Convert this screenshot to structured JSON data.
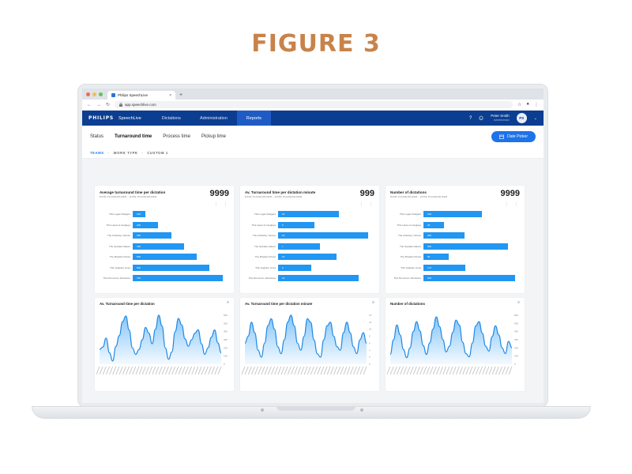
{
  "figure": {
    "title": "FIGURE 3"
  },
  "browser": {
    "tab_title": "Philips SpeechLive",
    "close_glyph": "×",
    "new_tab_glyph": "+",
    "url": "app.speechlive.com",
    "lock_icon": "lock-icon",
    "window_dot_colors": [
      "#ec6a5e",
      "#f4bf4f",
      "#61c554"
    ]
  },
  "header": {
    "brand": "PHILIPS",
    "product": "SpeechLive",
    "nav": [
      "Dictations",
      "Administration",
      "Reports"
    ],
    "active_nav": "Reports",
    "help": "?",
    "user_name": "Peter Smith",
    "user_sub": "Administrator",
    "avatar_initials": "PS",
    "colors": {
      "header_bg": "#0b3d91",
      "active_nav_bg": "#1f5bc4"
    }
  },
  "subnav": {
    "tabs": [
      "Status",
      "Turnaround time",
      "Process time",
      "Pickup time"
    ],
    "active_tab": "Turnaround time",
    "date_picker": "Date Picker"
  },
  "filters": {
    "items": [
      "TEAMS",
      "WORK TYPE",
      "CUSTOM 1"
    ],
    "separator": "·",
    "active": "TEAMS"
  },
  "bar_cards": [
    {
      "title": "Average turnaround time per dictation",
      "subtitle": "DATE PLACEHOLDER – DATE PLACEHOLDER",
      "value": "9999",
      "rows": [
        {
          "label": "This Logan Rodgers",
          "value": "100",
          "fraction": 0.14
        },
        {
          "label": "This Laura of Langleys",
          "value": "200",
          "fraction": 0.28
        },
        {
          "label": "The Amberley Joneze",
          "value": "300",
          "fraction": 0.42
        },
        {
          "label": "The Sysrake Nelson",
          "value": "400",
          "fraction": 0.56
        },
        {
          "label": "The Brooklyn Press",
          "value": "500",
          "fraction": 0.7
        },
        {
          "label": "This Jeighton Lines",
          "value": "600",
          "fraction": 0.84
        },
        {
          "label": "This Drummon Johnstone",
          "value": "700",
          "fraction": 0.98
        }
      ]
    },
    {
      "title": "Av. Turnaround time per dictation minute",
      "subtitle": "DATE PLACEHOLDER – DATE PLACEHOLDER",
      "value": "999",
      "rows": [
        {
          "label": "This Logan Rodgers",
          "value": "10",
          "fraction": 0.66
        },
        {
          "label": "This Laura of Langleys",
          "value": "6",
          "fraction": 0.4
        },
        {
          "label": "The Amberley Joneze",
          "value": "10",
          "fraction": 0.98
        },
        {
          "label": "The Sysrake Nelson",
          "value": "7",
          "fraction": 0.46
        },
        {
          "label": "The Brooklyn Press",
          "value": "10",
          "fraction": 0.64
        },
        {
          "label": "This Jeighton Lines",
          "value": "6",
          "fraction": 0.36
        },
        {
          "label": "This Drummon Johnstone",
          "value": "10",
          "fraction": 0.88
        }
      ]
    },
    {
      "title": "Number of dictations",
      "subtitle": "DATE PLACEHOLDER – DATE PLACEHOLDER",
      "value": "9999",
      "rows": [
        {
          "label": "This Logan Rodgers",
          "value": "100",
          "fraction": 0.64
        },
        {
          "label": "This Laura of Langleys",
          "value": "30",
          "fraction": 0.22
        },
        {
          "label": "The Amberley Joneze",
          "value": "200",
          "fraction": 0.45
        },
        {
          "label": "The Sysrake Nelson",
          "value": "300",
          "fraction": 0.92
        },
        {
          "label": "The Brooklyn Press",
          "value": "50",
          "fraction": 0.28
        },
        {
          "label": "This Jeighton Lines",
          "value": "170",
          "fraction": 0.46
        },
        {
          "label": "This Drummon Johnstone",
          "value": "200",
          "fraction": 1.0
        }
      ]
    }
  ],
  "area_cards": [
    {
      "title": "Av. Turnaround time per dictation",
      "menu_glyph": "≡",
      "y_ticks": [
        "600",
        "500",
        "400",
        "300",
        "200",
        "100",
        "0"
      ],
      "values": [
        180,
        210,
        320,
        140,
        40,
        220,
        350,
        520,
        590,
        420,
        200,
        120,
        180,
        300,
        450,
        380,
        250,
        430,
        600,
        470,
        200,
        60,
        150,
        400,
        560,
        480,
        310,
        220,
        300,
        380,
        420,
        250,
        120,
        200,
        330,
        420,
        260,
        140
      ]
    },
    {
      "title": "Av. Turnaround time per dictation minute",
      "menu_glyph": "≡",
      "y_ticks": [
        "14",
        "12",
        "10",
        "8",
        "6",
        "4",
        "2",
        "0"
      ],
      "values": [
        6,
        8,
        12,
        9,
        4,
        2,
        6,
        11,
        13,
        10,
        5,
        3,
        7,
        12,
        14,
        11,
        6,
        4,
        8,
        13,
        12,
        7,
        3,
        2,
        7,
        11,
        12,
        8,
        5,
        4,
        9,
        12,
        9,
        5,
        3,
        7,
        9,
        6
      ]
    },
    {
      "title": "Number of dictations",
      "menu_glyph": "≡",
      "y_ticks": [
        "600",
        "500",
        "400",
        "300",
        "200",
        "100",
        "0"
      ],
      "values": [
        120,
        300,
        480,
        360,
        180,
        80,
        200,
        400,
        520,
        410,
        230,
        120,
        260,
        430,
        580,
        460,
        300,
        150,
        220,
        390,
        540,
        480,
        270,
        130,
        90,
        260,
        470,
        520,
        380,
        220,
        160,
        340,
        470,
        360,
        200,
        130,
        280,
        200
      ]
    }
  ]
}
